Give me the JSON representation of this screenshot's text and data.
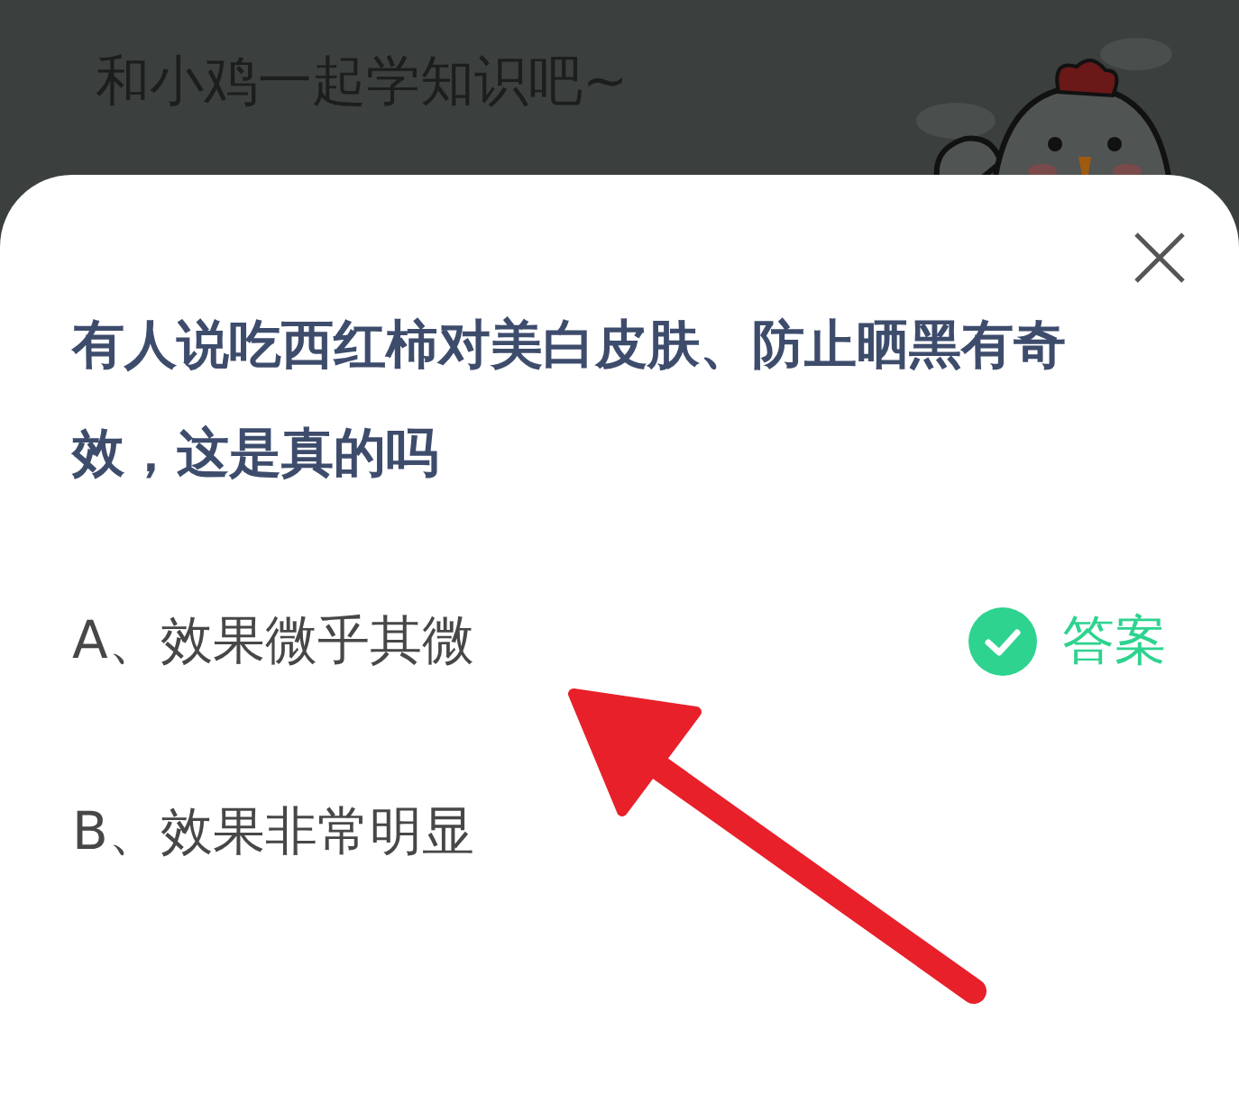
{
  "header": {
    "title": "和小鸡一起学知识吧~"
  },
  "quiz": {
    "question": "有人说吃西红柿对美白皮肤、防止晒黑有奇效，这是真的吗",
    "answer_label": "答案",
    "options": [
      {
        "text": "A、效果微乎其微",
        "correct": true
      },
      {
        "text": "B、效果非常明显",
        "correct": false
      }
    ]
  }
}
